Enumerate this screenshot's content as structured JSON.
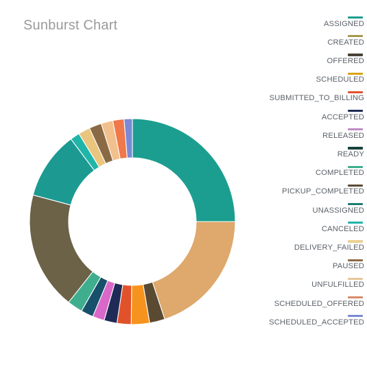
{
  "title": "Sunburst Chart",
  "legend": {
    "position": "right",
    "items": [
      {
        "label": "ASSIGNED",
        "color": "#1b9e8f"
      },
      {
        "label": "CREATED",
        "color": "#a59a4a"
      },
      {
        "label": "OFFERED",
        "color": "#4a4336"
      },
      {
        "label": "SCHEDULED",
        "color": "#d9a310"
      },
      {
        "label": "SUBMITTED_TO_BILLING",
        "color": "#e2522a"
      },
      {
        "label": "ACCEPTED",
        "color": "#1f2b56"
      },
      {
        "label": "RELEASED",
        "color": "#c18cc4"
      },
      {
        "label": "READY",
        "color": "#17413a"
      },
      {
        "label": "COMPLETED",
        "color": "#3fae8e"
      },
      {
        "label": "PICKUP_COMPLETED",
        "color": "#5a4a32"
      },
      {
        "label": "UNASSIGNED",
        "color": "#1c7c74"
      },
      {
        "label": "CANCELED",
        "color": "#1fb5a8"
      },
      {
        "label": "DELIVERY_FAILED",
        "color": "#ead092"
      },
      {
        "label": "PAUSED",
        "color": "#8a6a45"
      },
      {
        "label": "UNFULFILLED",
        "color": "#e8c79a"
      },
      {
        "label": "SCHEDULED_OFFERED",
        "color": "#d98a6a"
      },
      {
        "label": "SCHEDULED_ACCEPTED",
        "color": "#7b8ad4"
      }
    ]
  },
  "chart_data": {
    "type": "pie",
    "variant": "donut",
    "title": "Sunburst Chart",
    "xlabel": "",
    "ylabel": "",
    "start_angle_deg": 0,
    "direction": "clockwise",
    "hole_ratio": 0.62,
    "categories": [
      "ASSIGNED",
      "CREATED",
      "OFFERED",
      "SCHEDULED",
      "SUBMITTED_TO_BILLING",
      "ACCEPTED",
      "RELEASED",
      "READY",
      "COMPLETED",
      "PICKUP_COMPLETED",
      "UNASSIGNED",
      "CANCELED",
      "DELIVERY_FAILED",
      "PAUSED",
      "UNFULFILLED",
      "SCHEDULED_OFFERED",
      "SCHEDULED_ACCEPTED"
    ],
    "values": [
      27.0,
      21.5,
      2.6,
      3.1,
      2.4,
      2.2,
      2.0,
      2.1,
      2.6,
      20.0,
      11.5,
      1.6,
      2.0,
      2.1,
      2.0,
      1.9,
      1.4
    ],
    "colors": [
      "#1b9e8f",
      "#dfa86c",
      "#5a4a32",
      "#f6931e",
      "#e2522a",
      "#1f2b56",
      "#d968c9",
      "#17506a",
      "#3fae8e",
      "#6b6247",
      "#1c9a92",
      "#1fb5a8",
      "#eac57e",
      "#8a6a45",
      "#f2c08c",
      "#f0784a",
      "#7b8ad4"
    ],
    "units": "percent",
    "legend_position": "right",
    "grid": false
  }
}
